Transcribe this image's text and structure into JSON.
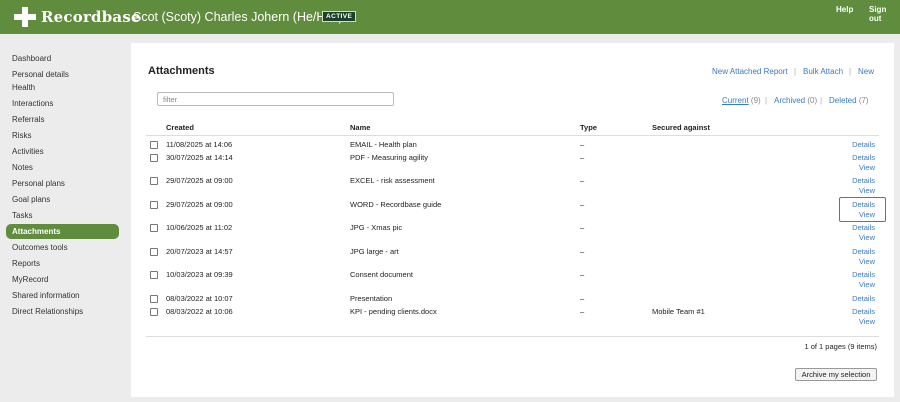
{
  "header": {
    "logo_text": "Recordbase",
    "person_name": "Scot (Scoty) Charles Johern (He/Him)",
    "status_badge": "ACTIVE",
    "help_label": "Help",
    "signout_label": "Sign out",
    "brand_color": "#5f8c3d"
  },
  "sidebar": {
    "items": [
      {
        "label": "Dashboard"
      },
      {
        "label": "Personal details"
      },
      {
        "label": "Health"
      },
      {
        "label": "Interactions"
      },
      {
        "label": "Referrals"
      },
      {
        "label": "Risks"
      },
      {
        "label": "Activities"
      },
      {
        "label": "Notes"
      },
      {
        "label": "Personal plans"
      },
      {
        "label": "Goal plans"
      },
      {
        "label": "Tasks"
      },
      {
        "label": "Attachments",
        "active": true
      },
      {
        "label": "Outcomes tools"
      },
      {
        "label": "Reports"
      },
      {
        "label": "MyRecord"
      },
      {
        "label": "Shared information"
      },
      {
        "label": "Direct Relationships"
      }
    ]
  },
  "main": {
    "title": "Attachments",
    "actions": {
      "new_attached_report": "New Attached Report",
      "bulk_attach": "Bulk Attach",
      "new": "New"
    },
    "filter_placeholder": "filter",
    "filters": {
      "current_label": "Current",
      "current_count": "(9)",
      "archived_label": "Archived",
      "archived_count": "(0)",
      "deleted_label": "Deleted",
      "deleted_count": "(7)"
    },
    "columns": {
      "created": "Created",
      "name": "Name",
      "type": "Type",
      "secured": "Secured against"
    },
    "rows": [
      {
        "created": "11/08/2025 at 14:06",
        "name": "EMAIL - Health plan",
        "type": "–",
        "secured": "",
        "details": "Details",
        "view": ""
      },
      {
        "created": "30/07/2025 at 14:14",
        "name": "PDF - Measuring agility",
        "type": "–",
        "secured": "",
        "details": "Details",
        "view": "View"
      },
      {
        "created": "29/07/2025 at 09:00",
        "name": "EXCEL - risk assessment",
        "type": "–",
        "secured": "",
        "details": "Details",
        "view": "View"
      },
      {
        "created": "29/07/2025 at 09:00",
        "name": "WORD - Recordbase guide",
        "type": "–",
        "secured": "",
        "details": "Details",
        "view": "View"
      },
      {
        "created": "10/06/2025 at 11:02",
        "name": "JPG - Xmas pic",
        "type": "–",
        "secured": "",
        "details": "Details",
        "view": "View"
      },
      {
        "created": "20/07/2023 at 14:57",
        "name": "JPG large - art",
        "type": "–",
        "secured": "",
        "details": "Details",
        "view": "View"
      },
      {
        "created": "10/03/2023 at 09:39",
        "name": "Consent document",
        "type": "–",
        "secured": "",
        "details": "Details",
        "view": "View"
      },
      {
        "created": "08/03/2022 at 10:07",
        "name": "Presentation",
        "type": "–",
        "secured": "",
        "details": "Details",
        "view": ""
      },
      {
        "created": "08/03/2022 at 10:06",
        "name": "KPI - pending clients.docx",
        "type": "–",
        "secured": "Mobile Team #1",
        "details": "Details",
        "view": "View"
      }
    ],
    "pagination": "1 of 1 pages (9 items)",
    "archive_button": "Archive my selection"
  }
}
